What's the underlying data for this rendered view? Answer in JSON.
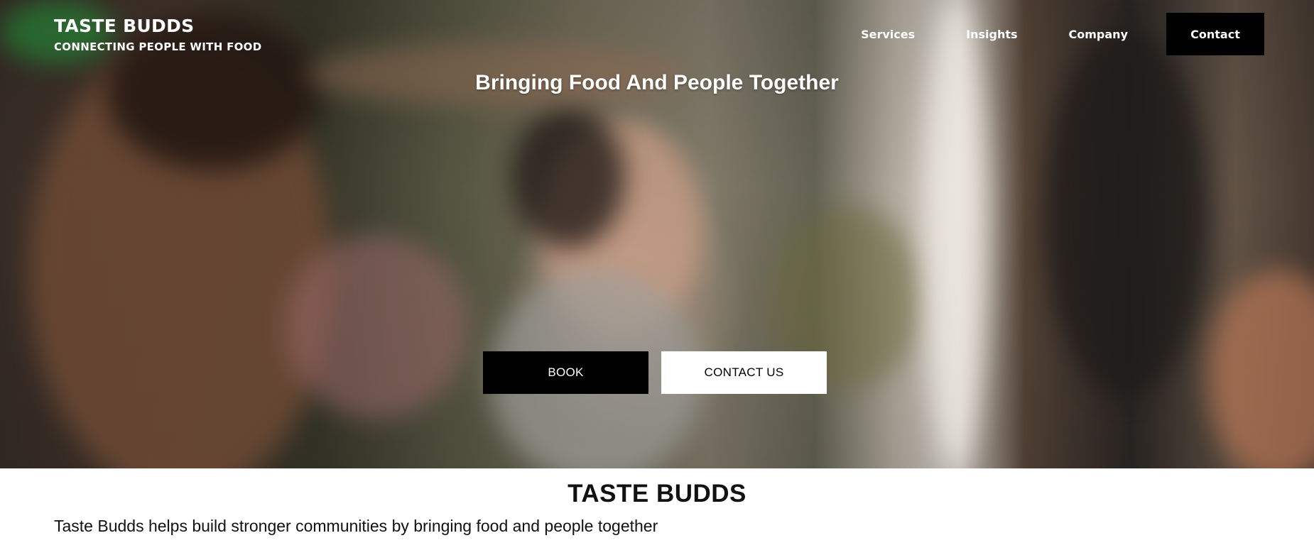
{
  "brand": {
    "name": "TASTE BUDDS",
    "tagline": "CONNECTING PEOPLE WITH FOOD"
  },
  "nav": {
    "items": [
      {
        "label": "Services"
      },
      {
        "label": "Insights"
      },
      {
        "label": "Company"
      }
    ],
    "contact_label": "Contact"
  },
  "hero": {
    "title": "Bringing Food And People Together",
    "book_label": "BOOK",
    "contact_label": "CONTACT US",
    "image_description": "Photo of people laughing at an outdoor restaurant table"
  },
  "about": {
    "title": "TASTE BUDDS",
    "description": "Taste Budds helps build stronger communities by bringing food and people together"
  },
  "colors": {
    "button_dark": "#000000",
    "button_light": "#ffffff",
    "text_dark": "#111111"
  }
}
